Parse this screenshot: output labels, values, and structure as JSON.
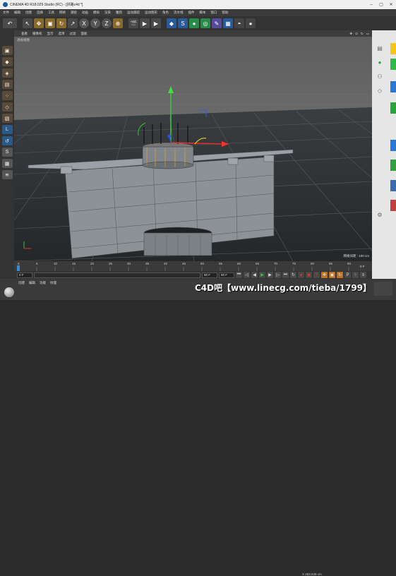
{
  "titlebar": {
    "title": "CINEMA 4D R18.029 Studio (RC) - [拱路c4d *]"
  },
  "menu": [
    "文件",
    "编辑",
    "创建",
    "选择",
    "工具",
    "网格",
    "捕捉",
    "动画",
    "模拟",
    "渲染",
    "雕刻",
    "运动跟踪",
    "运动图形",
    "角色",
    "流水线",
    "插件",
    "脚本",
    "窗口",
    "帮助"
  ],
  "toolbar": {
    "undo": "↶",
    "tools": [
      "↖",
      "✥",
      "▣",
      "↻",
      "↗",
      "X",
      "Y",
      "Z",
      "⊕",
      "🎬",
      "▶",
      "▶",
      "◆",
      "S",
      "●",
      "◎",
      "✎",
      "▦",
      "◓",
      "●"
    ]
  },
  "viewport": {
    "menu": [
      "查看",
      "摄像机",
      "显示",
      "选项",
      "过滤",
      "面板"
    ],
    "label": "透视视图",
    "grid_label": "网格间距 : 100 cm"
  },
  "timeline": {
    "ticks": [
      "0",
      "5",
      "10",
      "15",
      "20",
      "25",
      "30",
      "35",
      "40",
      "45",
      "50",
      "55",
      "60",
      "65",
      "70",
      "75",
      "80",
      "85",
      "90"
    ],
    "current_frame": "0 F"
  },
  "transport": {
    "start": "0 F",
    "end": "90 F",
    "max": "90 F"
  },
  "bottom": {
    "menu": [
      "创建",
      "编辑",
      "功能",
      "纹理"
    ],
    "coord": "X 283.049 cm"
  },
  "watermark": "C4D吧【www.linecg.com/tieba/1799】",
  "colors": {
    "accent": "#f0a030",
    "blue": "#3377cc"
  }
}
